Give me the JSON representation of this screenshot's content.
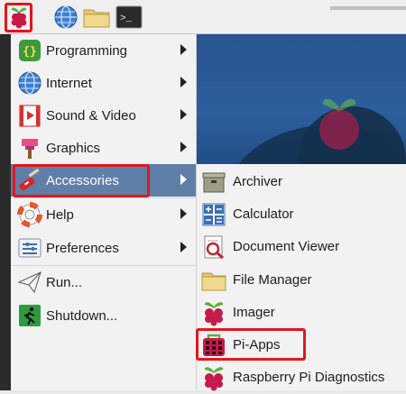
{
  "taskbar": {
    "raspberry_menu_icon": "raspberry-pi-logo",
    "browser_icon": "globe-icon",
    "files_icon": "folder-icon",
    "terminal_icon": "terminal-icon",
    "terminal_prompt": ">_"
  },
  "main_menu": {
    "items": [
      {
        "label": "Programming",
        "icon": "programming-icon",
        "has_submenu": true
      },
      {
        "label": "Internet",
        "icon": "globe-icon",
        "has_submenu": true
      },
      {
        "label": "Sound & Video",
        "icon": "film-icon",
        "has_submenu": true
      },
      {
        "label": "Graphics",
        "icon": "paint-icon",
        "has_submenu": true
      },
      {
        "label": "Accessories",
        "icon": "knife-icon",
        "has_submenu": true,
        "selected": true
      },
      {
        "label": "Help",
        "icon": "lifebuoy-icon",
        "has_submenu": true
      },
      {
        "label": "Preferences",
        "icon": "settings-icon",
        "has_submenu": true
      },
      {
        "label": "Run...",
        "icon": "paper-plane-icon",
        "has_submenu": false
      },
      {
        "label": "Shutdown...",
        "icon": "exit-icon",
        "has_submenu": false
      }
    ]
  },
  "submenu": {
    "items": [
      {
        "label": "Archiver",
        "icon": "archive-icon"
      },
      {
        "label": "Calculator",
        "icon": "calculator-icon"
      },
      {
        "label": "Document Viewer",
        "icon": "document-viewer-icon"
      },
      {
        "label": "File Manager",
        "icon": "folder-icon"
      },
      {
        "label": "Imager",
        "icon": "raspberry-pi-logo"
      },
      {
        "label": "Pi-Apps",
        "icon": "pi-apps-icon",
        "highlighted": true
      },
      {
        "label": "Raspberry Pi Diagnostics",
        "icon": "raspberry-pi-logo"
      }
    ]
  },
  "colors": {
    "selection": "#5f7fa8",
    "annotation_red": "#e5151c",
    "menu_bg": "#f2f2f2",
    "desktop_blue": "#2d5f9e"
  }
}
